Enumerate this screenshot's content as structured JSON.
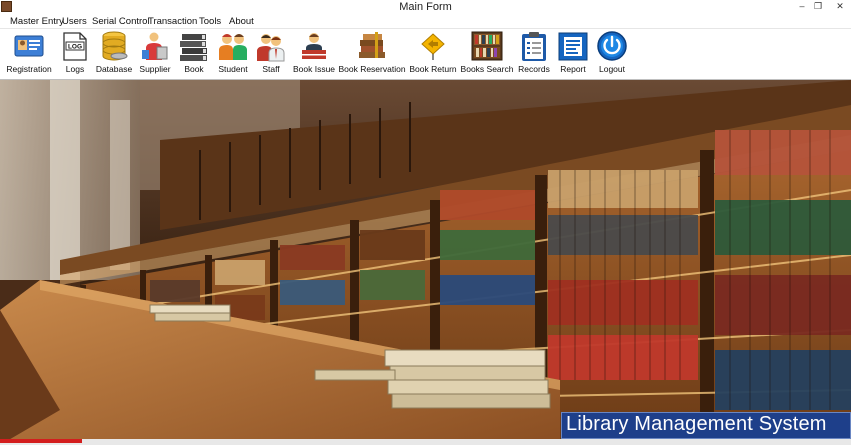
{
  "window": {
    "title": "Main Form",
    "minimize_glyph": "–",
    "maximize_glyph": "❐",
    "close_glyph": "✕"
  },
  "menu": [
    {
      "label": "Master Entry"
    },
    {
      "label": "Users"
    },
    {
      "label": "Serial Control"
    },
    {
      "label": "Transaction"
    },
    {
      "label": "Tools"
    },
    {
      "label": "About"
    }
  ],
  "toolbar": [
    {
      "label": "Registration",
      "icon": "registration-card-icon"
    },
    {
      "label": "Logs",
      "icon": "log-file-icon"
    },
    {
      "label": "Database",
      "icon": "database-icon"
    },
    {
      "label": "Supplier",
      "icon": "supplier-icon"
    },
    {
      "label": "Book",
      "icon": "books-stack-icon"
    },
    {
      "label": "Student",
      "icon": "students-icon"
    },
    {
      "label": "Staff",
      "icon": "staff-icon"
    },
    {
      "label": "Book Issue",
      "icon": "book-issue-icon"
    },
    {
      "label": "Book Reservation",
      "icon": "book-reservation-icon"
    },
    {
      "label": "Book Return",
      "icon": "book-return-icon"
    },
    {
      "label": "Books Search",
      "icon": "books-search-icon"
    },
    {
      "label": "Records",
      "icon": "records-clipboard-icon"
    },
    {
      "label": "Report",
      "icon": "report-icon"
    },
    {
      "label": "Logout",
      "icon": "power-icon"
    }
  ],
  "banner": {
    "text": "Library Management System"
  },
  "colors": {
    "banner_bg": "#1e3f8a",
    "logout_blue": "#1565c0",
    "wood": "#8a4e22"
  }
}
